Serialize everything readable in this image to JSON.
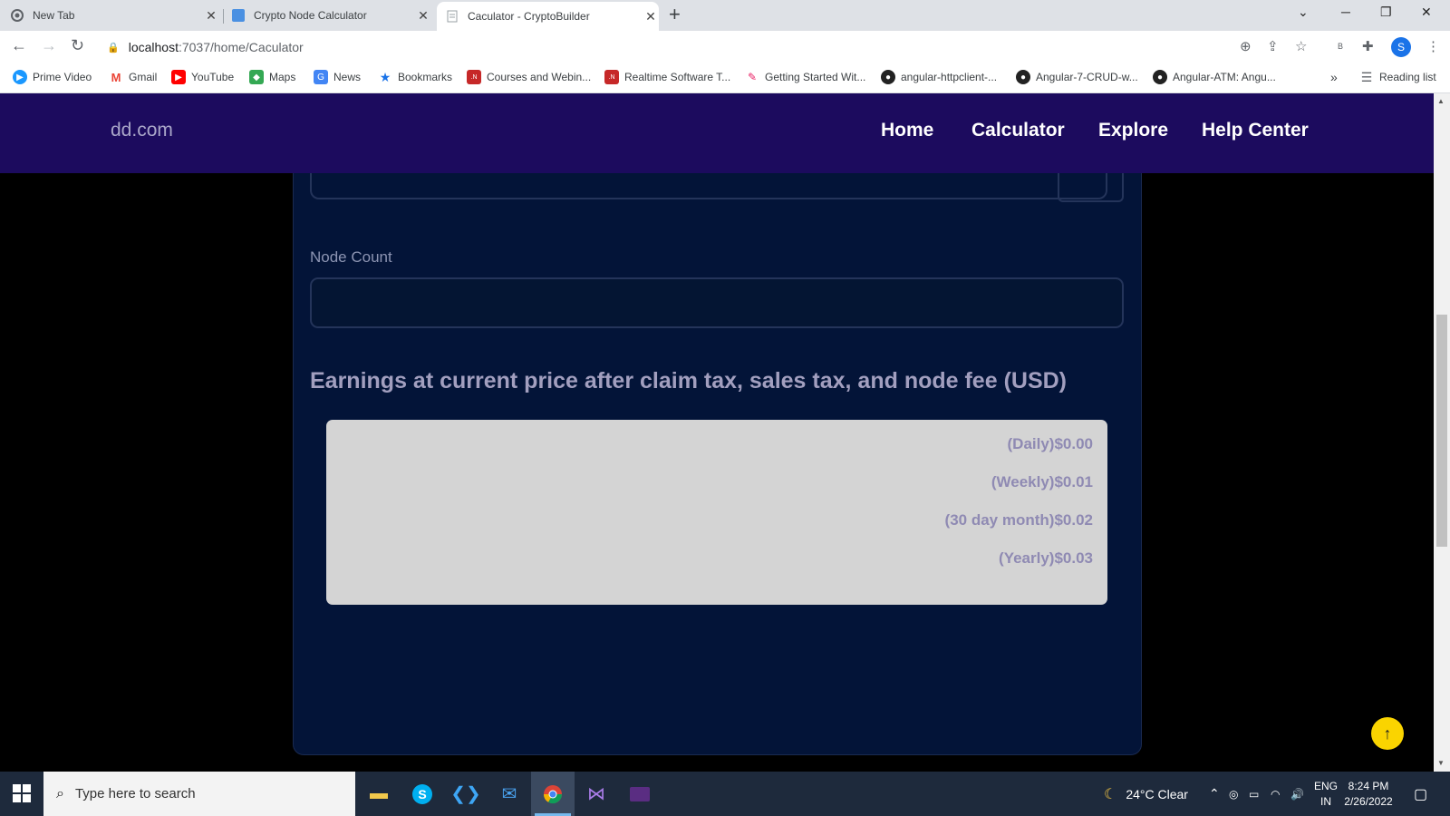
{
  "browser": {
    "tabs": [
      {
        "title": "New Tab",
        "icon": "chrome-icon"
      },
      {
        "title": "Crypto Node Calculator",
        "icon": "site-icon"
      },
      {
        "title": "Caculator - CryptoBuilder",
        "icon": "page-icon"
      }
    ],
    "url_host": "localhost",
    "url_path": ":7037/home/Caculator",
    "profile_initial": "S",
    "bookmarks": [
      "Prime Video",
      "Gmail",
      "YouTube",
      "Maps",
      "News",
      "Bookmarks",
      "Courses and Webin...",
      "Realtime Software T...",
      "Getting Started Wit...",
      "angular-httpclient-...",
      "Angular-7-CRUD-w...",
      "Angular-ATM: Angu..."
    ],
    "reading_list": "Reading list",
    "more_bookmarks": "»"
  },
  "site": {
    "brand": "dd.com",
    "nav": [
      "Home",
      "Calculator",
      "Explore",
      "Help Center"
    ]
  },
  "form": {
    "node_count_label": "Node Count",
    "node_count_value": ""
  },
  "earnings": {
    "title": "Earnings at current price after claim tax, sales tax, and node fee (USD)",
    "rows": [
      "(Daily)$0.00",
      "(Weekly)$0.01",
      "(30 day month)$0.02",
      "(Yearly)$0.03"
    ]
  },
  "taskbar": {
    "search_placeholder": "Type here to search",
    "weather": "24°C  Clear",
    "lang_top": "ENG",
    "lang_bottom": "IN",
    "time": "8:24 PM",
    "date": "2/26/2022"
  },
  "colors": {
    "navbar": "#1c0b5e",
    "card": "#031438",
    "accent_button": "#fad400"
  }
}
